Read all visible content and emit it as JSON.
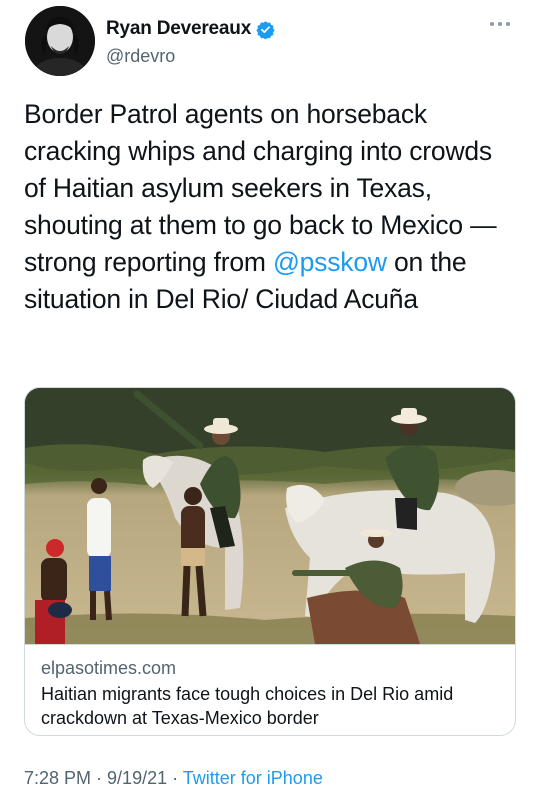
{
  "author": {
    "name": "Ryan Devereaux",
    "handle": "@rdevro",
    "verified": true
  },
  "tweet": {
    "text_part1": "Border Patrol agents on horseback cracking whips and charging into crowds of Haitian asylum seekers in Texas, shouting at them to go back to Mexico — strong reporting from ",
    "mention": "@psskow",
    "text_part2": " on the situation in Del Rio/ Ciudad Acuña"
  },
  "card": {
    "domain": "elpasotimes.com",
    "title": "Haitian migrants face tough choices in Del Rio amid crackdown at Texas-Mexico border"
  },
  "meta": {
    "time": "7:28 PM",
    "separator": " · ",
    "date": "9/19/21",
    "source": "Twitter for iPhone"
  },
  "colors": {
    "accent": "#1d9bf0",
    "secondary_text": "#536471",
    "border": "#cfd9de"
  },
  "icons": [
    "verified-badge-icon",
    "more-options-icon"
  ]
}
